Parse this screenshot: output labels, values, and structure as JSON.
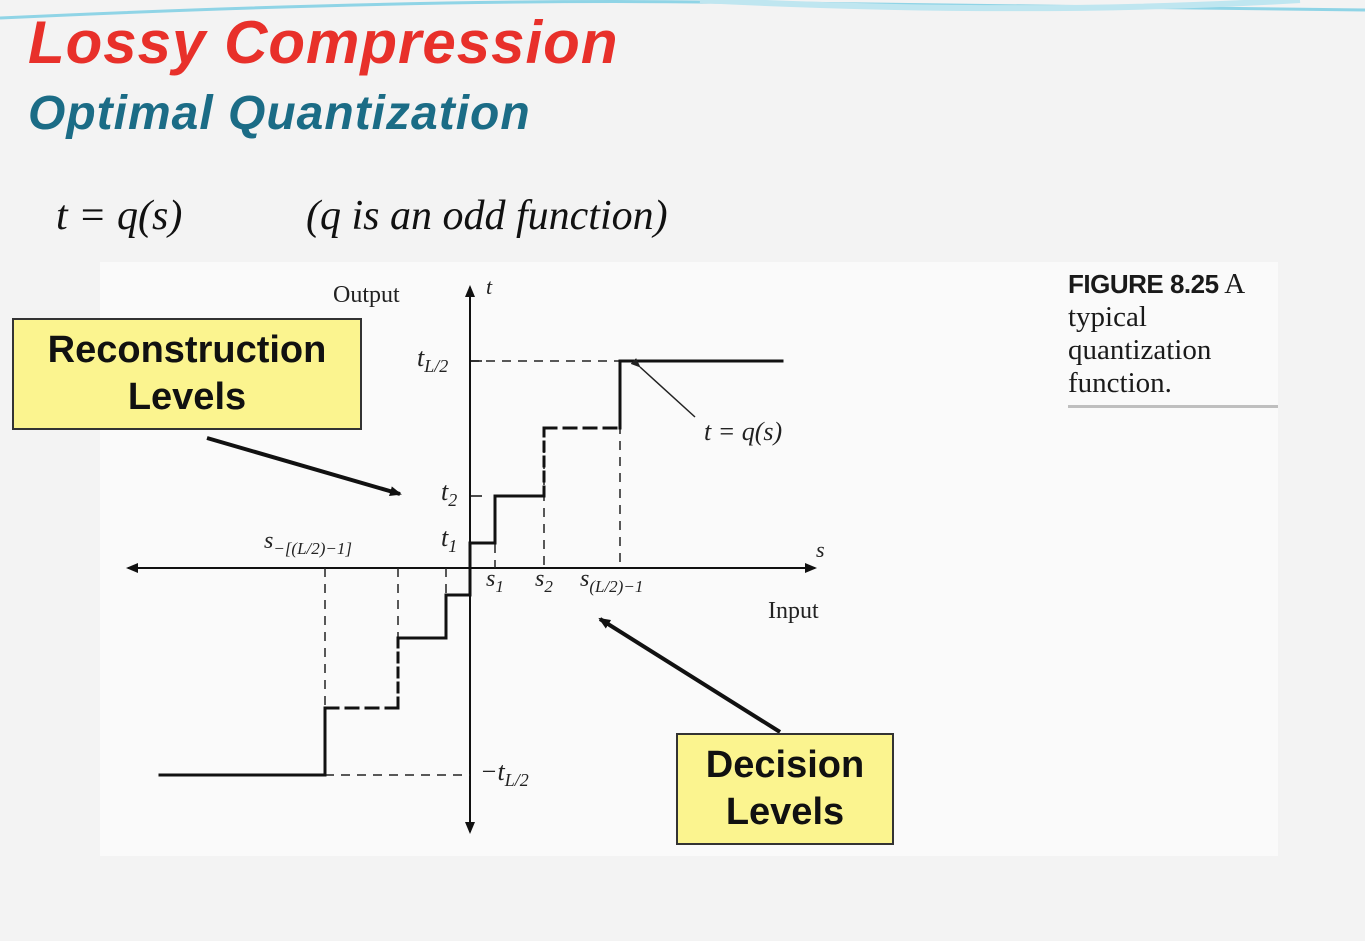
{
  "slide": {
    "title": "Lossy Compression",
    "subtitle": "Optimal Quantization",
    "equation": {
      "lhs": "t = q(s)",
      "rhs": "(q is an odd  function)"
    }
  },
  "figure": {
    "caption_number": "FIGURE 8.25",
    "caption_text": " A typical quantization function.",
    "axis_output_label": "Output",
    "axis_input_label": "Input",
    "axis_t": "t",
    "axis_s": "s",
    "levels": {
      "t_l2": {
        "base": "t",
        "sub": "L/2"
      },
      "t2": {
        "base": "t",
        "sub": "2"
      },
      "t1": {
        "base": "t",
        "sub": "1"
      },
      "neg_t_l2": {
        "base": "−t",
        "sub": "L/2"
      },
      "s1": {
        "base": "s",
        "sub": "1"
      },
      "s2": {
        "base": "s",
        "sub": "2"
      },
      "s_l2_minus1": {
        "base": "s",
        "sub": "(L/2)−1"
      },
      "s_neg": {
        "base": "s",
        "sub": "−[(L/2)−1]"
      }
    },
    "curve_label": "t = q(s)"
  },
  "callouts": {
    "reconstruction": [
      "Reconstruction",
      "Levels"
    ],
    "decision": [
      "Decision",
      "Levels"
    ]
  },
  "colors": {
    "title": "#e8302a",
    "subtitle": "#1b6c86",
    "callout_fill": "#fbf48f"
  }
}
